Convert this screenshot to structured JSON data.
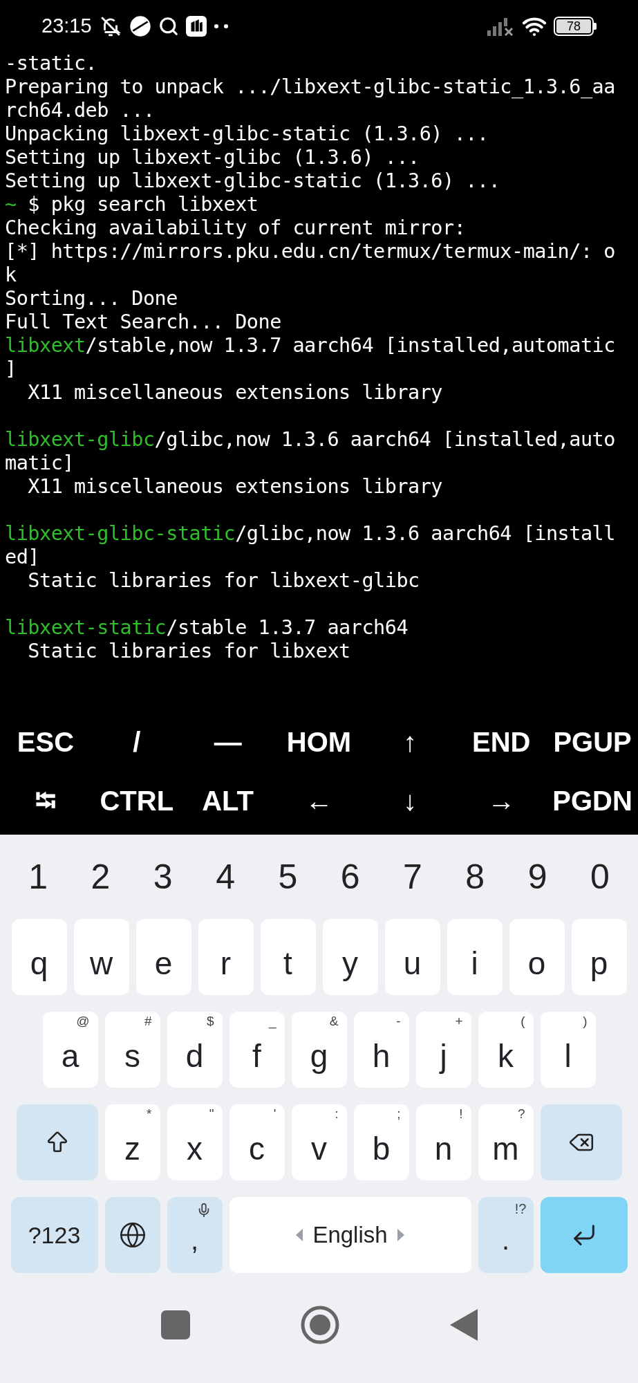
{
  "status_bar": {
    "time": "23:15",
    "battery": "78"
  },
  "terminal": {
    "blocks": [
      {
        "lines": [
          [
            {
              "text": "-static.",
              "kind": "plain"
            }
          ],
          [
            {
              "text": "Preparing to unpack .../libxext-glibc-static_1.3.6_aa",
              "kind": "plain"
            }
          ],
          [
            {
              "text": "rch64.deb ...",
              "kind": "plain"
            }
          ],
          [
            {
              "text": "Unpacking libxext-glibc-static (1.3.6) ...",
              "kind": "plain"
            }
          ],
          [
            {
              "text": "Setting up libxext-glibc (1.3.6) ...",
              "kind": "plain"
            }
          ],
          [
            {
              "text": "Setting up libxext-glibc-static (1.3.6) ...",
              "kind": "plain"
            }
          ],
          [
            {
              "text": "~",
              "kind": "green"
            },
            {
              "text": " $ pkg search libxext",
              "kind": "plain"
            }
          ],
          [
            {
              "text": "Checking availability of current mirror:",
              "kind": "plain"
            }
          ],
          [
            {
              "text": "[*] https://mirrors.pku.edu.cn/termux/termux-main/: o",
              "kind": "plain"
            }
          ],
          [
            {
              "text": "k",
              "kind": "plain"
            }
          ],
          [
            {
              "text": "Sorting... Done",
              "kind": "plain"
            }
          ],
          [
            {
              "text": "Full Text Search... Done",
              "kind": "plain"
            }
          ],
          [
            {
              "text": "libxext",
              "kind": "green"
            },
            {
              "text": "/stable,now 1.3.7 aarch64 [installed,automatic",
              "kind": "plain"
            }
          ],
          [
            {
              "text": "]",
              "kind": "plain"
            }
          ],
          [
            {
              "text": "  X11 miscellaneous extensions library",
              "kind": "plain"
            }
          ]
        ]
      },
      {
        "lines": [
          [
            {
              "text": "libxext-glibc",
              "kind": "green"
            },
            {
              "text": "/glibc,now 1.3.6 aarch64 [installed,auto",
              "kind": "plain"
            }
          ],
          [
            {
              "text": "matic]",
              "kind": "plain"
            }
          ],
          [
            {
              "text": "  X11 miscellaneous extensions library",
              "kind": "plain"
            }
          ]
        ]
      },
      {
        "lines": [
          [
            {
              "text": "libxext-glibc-static",
              "kind": "green"
            },
            {
              "text": "/glibc,now 1.3.6 aarch64 [install",
              "kind": "plain"
            }
          ],
          [
            {
              "text": "ed]",
              "kind": "plain"
            }
          ],
          [
            {
              "text": "  Static libraries for libxext-glibc",
              "kind": "plain"
            }
          ]
        ]
      },
      {
        "lines": [
          [
            {
              "text": "libxext-static",
              "kind": "green"
            },
            {
              "text": "/stable 1.3.7 aarch64",
              "kind": "plain"
            }
          ],
          [
            {
              "text": "  Static libraries for libxext",
              "kind": "plain"
            }
          ]
        ]
      }
    ]
  },
  "extra_keys": [
    [
      {
        "label": "ESC"
      },
      {
        "label": "/"
      },
      {
        "label": "—"
      },
      {
        "label": "HOM"
      },
      {
        "label": "↑"
      },
      {
        "label": "END"
      },
      {
        "label": "PGUP"
      }
    ],
    [
      {
        "label": "⭾"
      },
      {
        "label": "CTRL"
      },
      {
        "label": "ALT"
      },
      {
        "label": "←"
      },
      {
        "label": "↓"
      },
      {
        "label": "→"
      },
      {
        "label": "PGDN"
      }
    ]
  ],
  "keyboard": {
    "number_row": [
      "1",
      "2",
      "3",
      "4",
      "5",
      "6",
      "7",
      "8",
      "9",
      "0"
    ],
    "rows": [
      [
        {
          "kind": "letter",
          "label": "q"
        },
        {
          "kind": "letter",
          "label": "w"
        },
        {
          "kind": "letter",
          "label": "e"
        },
        {
          "kind": "letter",
          "label": "r"
        },
        {
          "kind": "letter",
          "label": "t"
        },
        {
          "kind": "letter",
          "label": "y"
        },
        {
          "kind": "letter",
          "label": "u"
        },
        {
          "kind": "letter",
          "label": "i"
        },
        {
          "kind": "letter",
          "label": "o"
        },
        {
          "kind": "letter",
          "label": "p"
        }
      ],
      [
        {
          "kind": "letter",
          "label": "a",
          "hint": "@"
        },
        {
          "kind": "letter",
          "label": "s",
          "hint": "#"
        },
        {
          "kind": "letter",
          "label": "d",
          "hint": "$"
        },
        {
          "kind": "letter",
          "label": "f",
          "hint": "_"
        },
        {
          "kind": "letter",
          "label": "g",
          "hint": "&"
        },
        {
          "kind": "letter",
          "label": "h",
          "hint": "-"
        },
        {
          "kind": "letter",
          "label": "j",
          "hint": "+"
        },
        {
          "kind": "letter",
          "label": "k",
          "hint": "("
        },
        {
          "kind": "letter",
          "label": "l",
          "hint": ")"
        }
      ],
      [
        {
          "kind": "shift"
        },
        {
          "kind": "letter",
          "label": "z",
          "hint": "*"
        },
        {
          "kind": "letter",
          "label": "x",
          "hint": "\""
        },
        {
          "kind": "letter",
          "label": "c",
          "hint": "'"
        },
        {
          "kind": "letter",
          "label": "v",
          "hint": ":"
        },
        {
          "kind": "letter",
          "label": "b",
          "hint": ";"
        },
        {
          "kind": "letter",
          "label": "n",
          "hint": "!"
        },
        {
          "kind": "letter",
          "label": "m",
          "hint": "?"
        },
        {
          "kind": "backspace"
        }
      ]
    ],
    "bottom_row": {
      "keys": [
        {
          "kind": "symbols",
          "label": "?123"
        },
        {
          "kind": "globe"
        },
        {
          "kind": "comma",
          "label": ","
        },
        {
          "kind": "space",
          "label": "English"
        },
        {
          "kind": "period",
          "label": ".",
          "hint": "!?"
        },
        {
          "kind": "enter"
        }
      ]
    }
  }
}
